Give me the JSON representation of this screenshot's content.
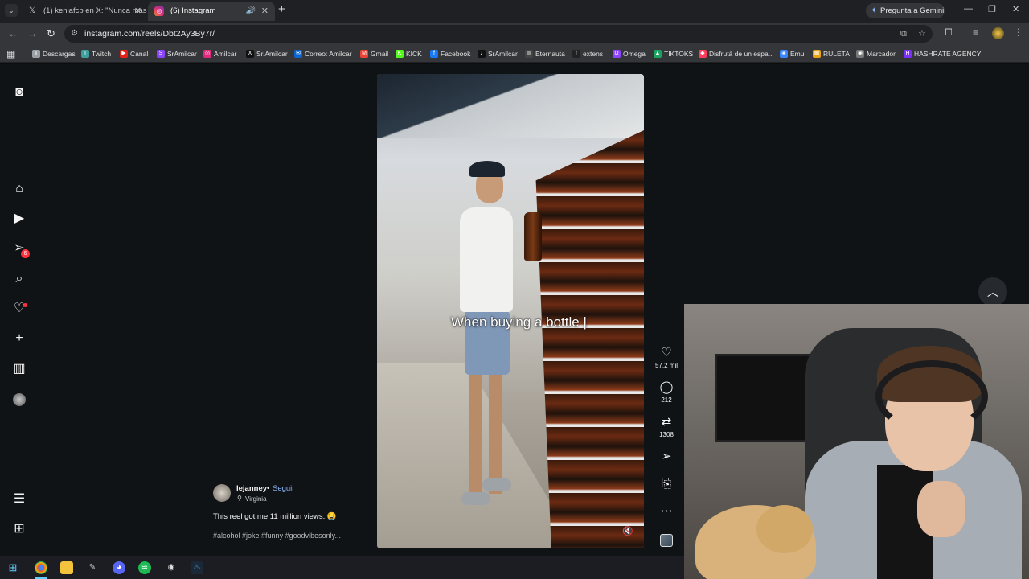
{
  "browser": {
    "tabs": [
      {
        "title": "(1) keniafcb en X: \"Nunca más",
        "icon": "x-logo-icon"
      },
      {
        "title": "(6) Instagram",
        "icon": "instagram-icon",
        "active": true
      }
    ],
    "new_tab": "+",
    "gemini_label": "Pregunta a Gemini",
    "url": "instagram.com/reels/Dbt2Ay3By7r/"
  },
  "bookmarks": [
    {
      "label": "Descargas",
      "color": "#9aa0a6",
      "glyph": "⭳"
    },
    {
      "label": "Twitch",
      "color": "#3d9ea0",
      "glyph": "T"
    },
    {
      "label": "Canal",
      "color": "#e62117",
      "glyph": "▶"
    },
    {
      "label": "SrAmilcar",
      "color": "#8b44ff",
      "glyph": "S"
    },
    {
      "label": "Amilcar",
      "color": "#dd2a7b",
      "glyph": "◎"
    },
    {
      "label": "Sr.Amilcar",
      "color": "#111111",
      "glyph": "X"
    },
    {
      "label": "Correo: Amilcar",
      "color": "#0a64d0",
      "glyph": "✉"
    },
    {
      "label": "Gmail",
      "color": "#ea4335",
      "glyph": "M"
    },
    {
      "label": "KICK",
      "color": "#53fc18",
      "glyph": "K"
    },
    {
      "label": "Facebook",
      "color": "#1877f2",
      "glyph": "f"
    },
    {
      "label": "SrAmilcar",
      "color": "#111111",
      "glyph": "♪"
    },
    {
      "label": "Eternauta",
      "color": "#444444",
      "glyph": "▤"
    },
    {
      "label": "extens",
      "color": "#222222",
      "glyph": "⭡"
    },
    {
      "label": "Omega",
      "color": "#8b44ff",
      "glyph": "Ω"
    },
    {
      "label": "TIKTOKS",
      "color": "#1aa260",
      "glyph": "▲"
    },
    {
      "label": "Disfrutá de un espa...",
      "color": "#ff3b5c",
      "glyph": "◆"
    },
    {
      "label": "Emu",
      "color": "#3a86ff",
      "glyph": "◈"
    },
    {
      "label": "RULETA",
      "color": "#e8a317",
      "glyph": "▦"
    },
    {
      "label": "Marcador",
      "color": "#777777",
      "glyph": "◉"
    },
    {
      "label": "HASHRATE AGENCY",
      "color": "#7b2ff7",
      "glyph": "H"
    }
  ],
  "sidenav": {
    "notifications_badge": "6"
  },
  "reel": {
    "overlay_text": "When buying a bottle |",
    "likes": "57,2 mil",
    "comments": "212",
    "reposts": "1308",
    "username": "lejanney",
    "separator": "•",
    "follow": "Seguir",
    "location": "Virginia",
    "caption": "This reel got me 11 million views. 😭",
    "hashtags": "#alcohol #joke #funny #goodvibesonly..."
  },
  "colors": {
    "accent": "#8ab4f8",
    "badge": "#ff3040"
  }
}
